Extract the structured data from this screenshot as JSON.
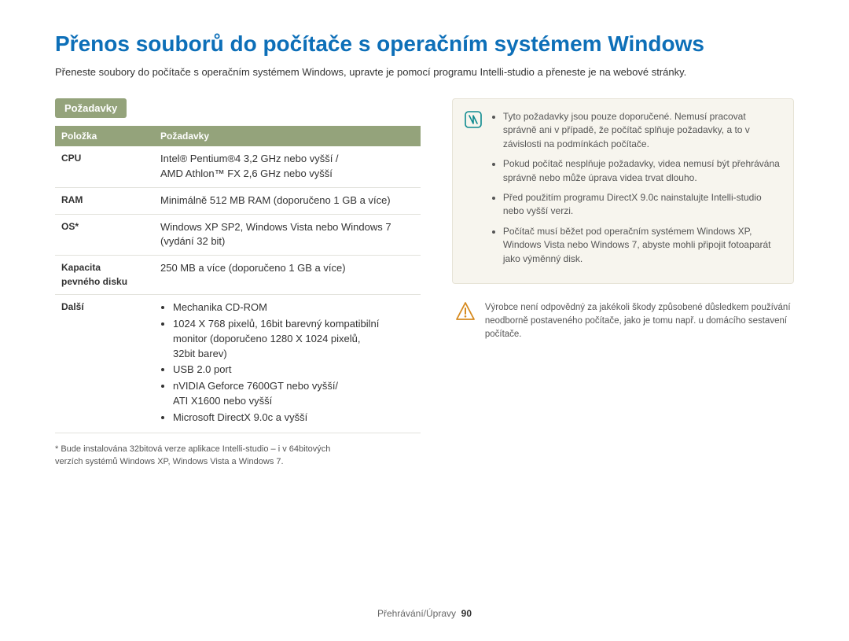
{
  "title": "Přenos souborů do počítače s operačním systémem Windows",
  "intro": "Přeneste soubory do počítače s operačním systémem Windows, upravte je pomocí programu Intelli-studio a přeneste je na webové stránky.",
  "badge": "Požadavky",
  "headers": {
    "col1": "Položka",
    "col2": "Požadavky"
  },
  "rows": {
    "cpu": {
      "label": "CPU",
      "line1": "Intel® Pentium®4 3,2 GHz nebo vyšší /",
      "line2": "AMD Athlon™ FX 2,6 GHz nebo vyšší"
    },
    "ram": {
      "label": "RAM",
      "value": "Minimálně 512 MB RAM (doporučeno 1 GB a více)"
    },
    "os": {
      "label": "OS*",
      "line1": "Windows XP SP2, Windows Vista nebo Windows 7",
      "line2": "(vydání 32 bit)"
    },
    "storage": {
      "label1": "Kapacita",
      "label2": "pevného disku",
      "value": "250 MB a více (doporučeno 1 GB a více)"
    },
    "other": {
      "label": "Další",
      "b1": "Mechanika CD-ROM",
      "b2a": "1024 X 768 pixelů, 16bit barevný kompatibilní",
      "b2b": "monitor (doporučeno 1280 X 1024 pixelů,",
      "b2c": "32bit barev)",
      "b3": "USB 2.0 port",
      "b4a": "nVIDIA Geforce 7600GT nebo vyšší/",
      "b4b": "ATI X1600 nebo vyšší",
      "b5": "Microsoft DirectX 9.0c a vyšší"
    }
  },
  "footnote": {
    "l1": "* Bude instalována 32bitová verze aplikace Intelli-studio – i v 64bitových",
    "l2": "verzích systémů Windows XP, Windows Vista a Windows 7."
  },
  "note": {
    "b1": "Tyto požadavky jsou pouze doporučené. Nemusí pracovat správně ani v případě, že počítač splňuje požadavky, a to v závislosti na podmínkách počítače.",
    "b2": "Pokud počítač nesplňuje požadavky, videa nemusí být přehrávána správně nebo může úprava videa trvat dlouho.",
    "b3": "Před použitím programu DirectX 9.0c nainstalujte Intelli-studio nebo vyšší verzi.",
    "b4": "Počítač musí běžet pod operačním systémem Windows XP, Windows Vista nebo Windows 7, abyste mohli připojit fotoaparát jako výměnný disk."
  },
  "warn": "Výrobce není odpovědný za jakékoli škody způsobené důsledkem používání neodborně postaveného počítače, jako je tomu např. u domácího sestavení počítače.",
  "footer": {
    "section": "Přehrávání/Úpravy",
    "page": "90"
  }
}
